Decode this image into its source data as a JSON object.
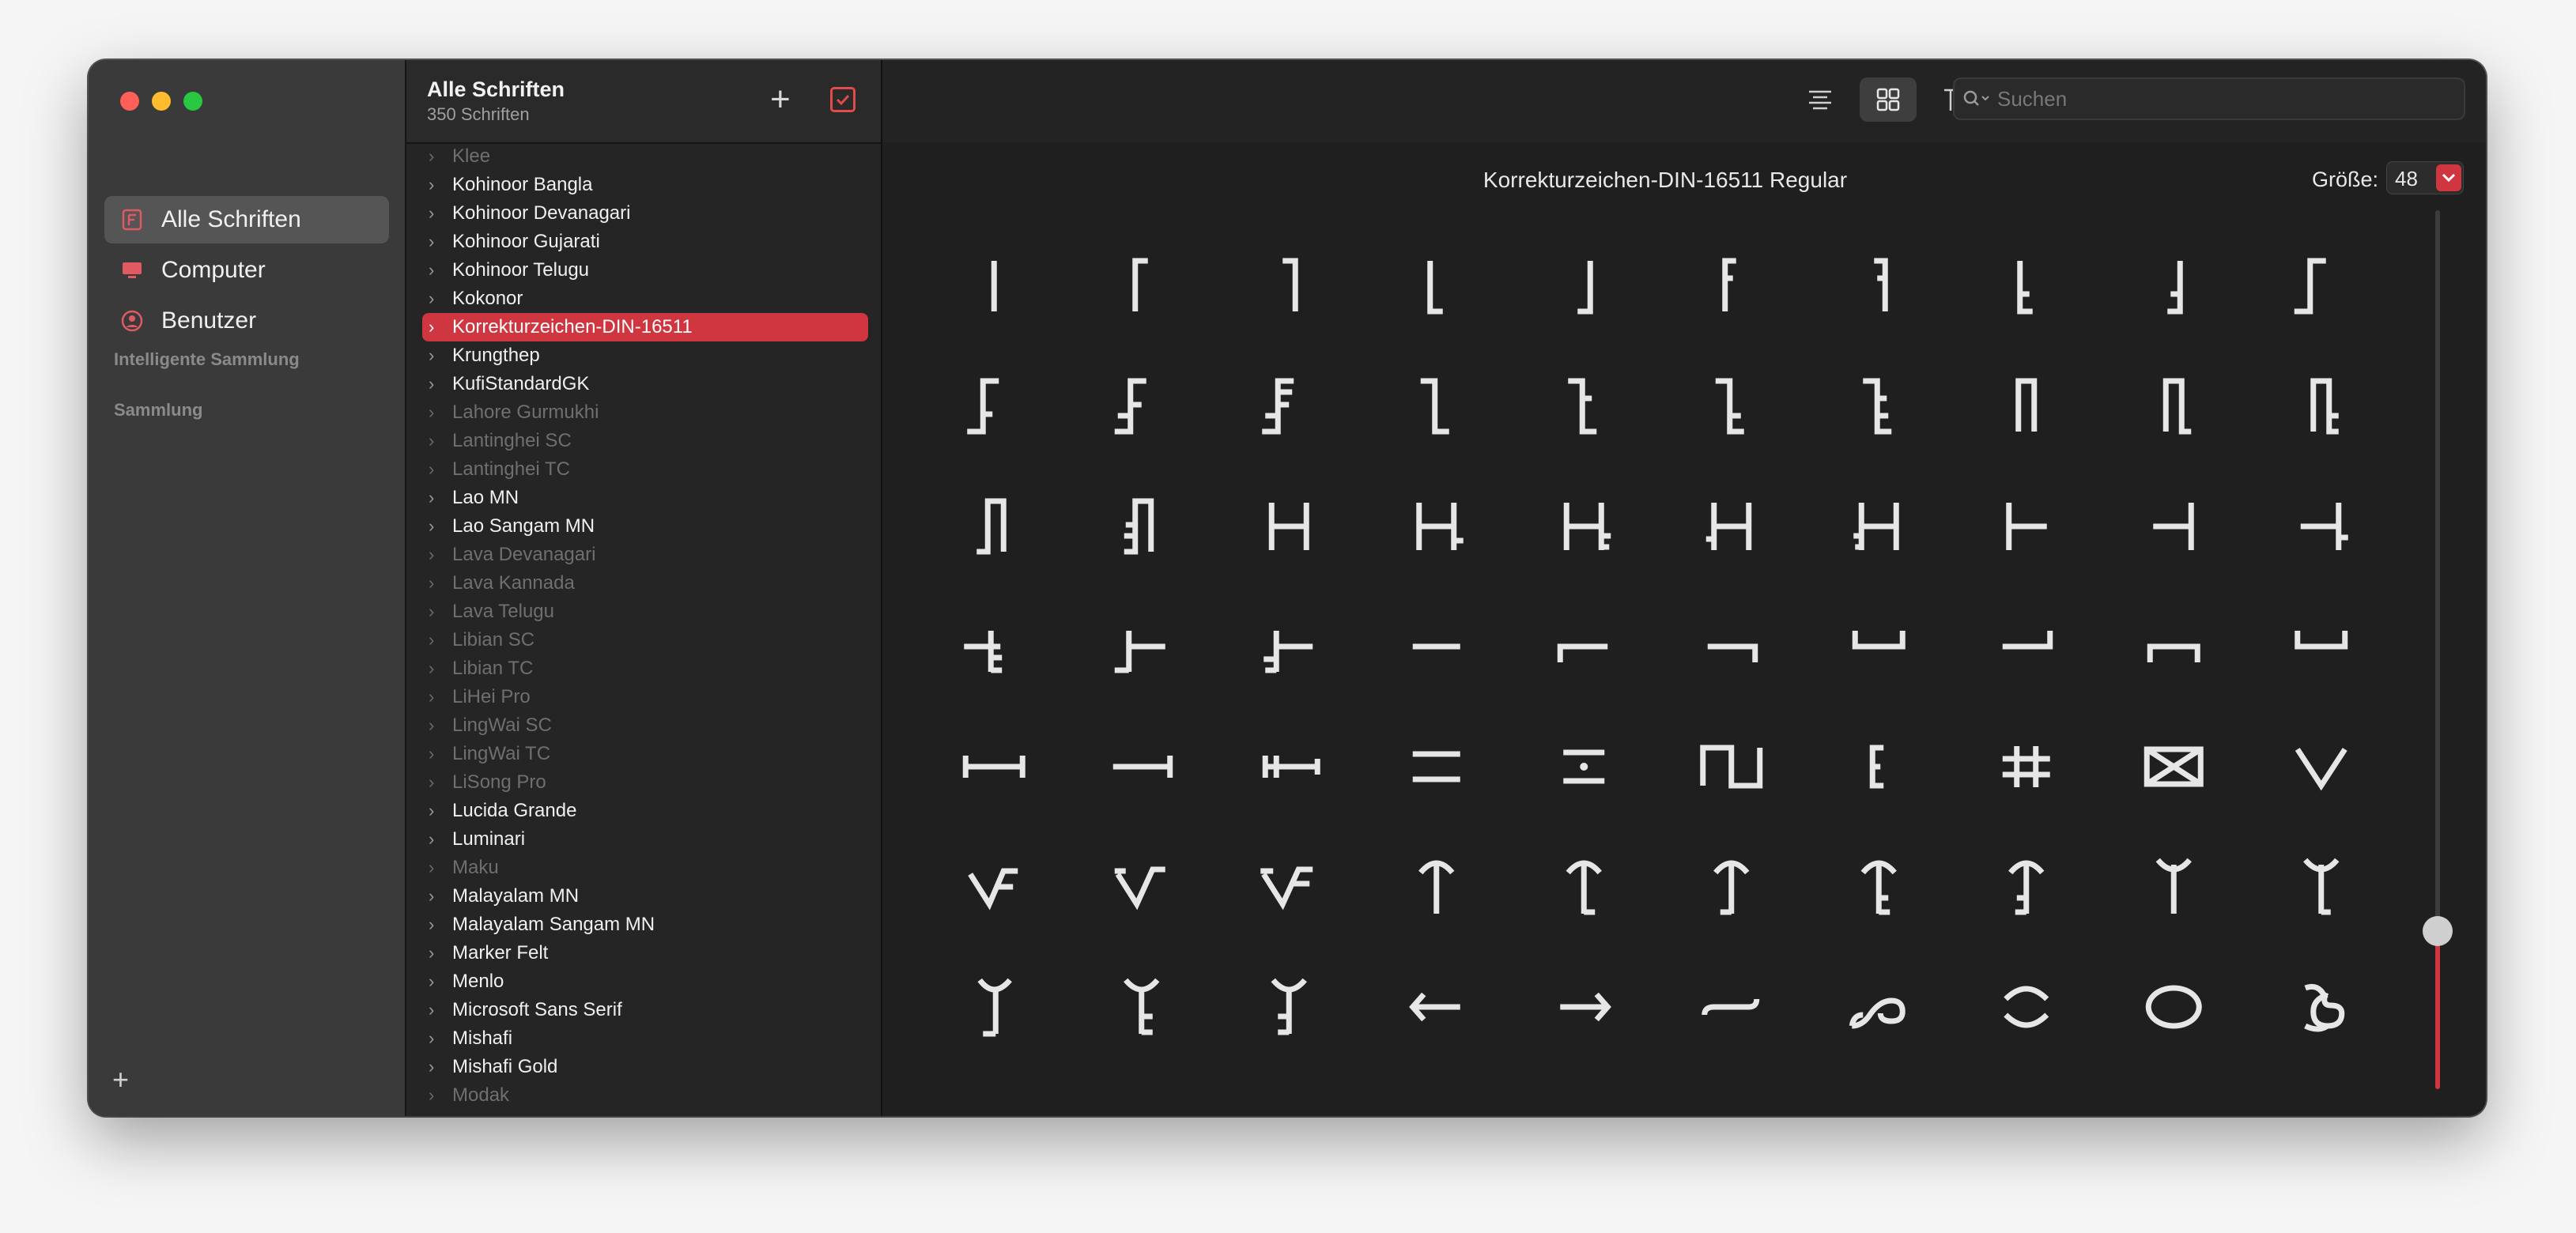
{
  "sidebar": {
    "items": [
      {
        "label": "Alle Schriften",
        "icon": "font-book-icon",
        "active": true
      },
      {
        "label": "Computer",
        "icon": "computer-icon",
        "active": false
      },
      {
        "label": "Benutzer",
        "icon": "user-icon",
        "active": false
      }
    ],
    "sections": [
      "Intelligente Sammlung",
      "Sammlung"
    ],
    "add_symbol": "+"
  },
  "font_list": {
    "title": "Alle Schriften",
    "subtitle": "350 Schriften",
    "fonts": [
      {
        "name": "Klee",
        "dim": true
      },
      {
        "name": "Kohinoor Bangla",
        "dim": false
      },
      {
        "name": "Kohinoor Devanagari",
        "dim": false
      },
      {
        "name": "Kohinoor Gujarati",
        "dim": false
      },
      {
        "name": "Kohinoor Telugu",
        "dim": false
      },
      {
        "name": "Kokonor",
        "dim": false
      },
      {
        "name": "Korrekturzeichen-DIN-16511",
        "dim": false,
        "selected": true
      },
      {
        "name": "Krungthep",
        "dim": false
      },
      {
        "name": "KufiStandardGK",
        "dim": false
      },
      {
        "name": "Lahore Gurmukhi",
        "dim": true
      },
      {
        "name": "Lantinghei SC",
        "dim": true
      },
      {
        "name": "Lantinghei TC",
        "dim": true
      },
      {
        "name": "Lao MN",
        "dim": false
      },
      {
        "name": "Lao Sangam MN",
        "dim": false
      },
      {
        "name": "Lava Devanagari",
        "dim": true
      },
      {
        "name": "Lava Kannada",
        "dim": true
      },
      {
        "name": "Lava Telugu",
        "dim": true
      },
      {
        "name": "Libian SC",
        "dim": true
      },
      {
        "name": "Libian TC",
        "dim": true
      },
      {
        "name": "LiHei Pro",
        "dim": true
      },
      {
        "name": "LingWai SC",
        "dim": true
      },
      {
        "name": "LingWai TC",
        "dim": true
      },
      {
        "name": "LiSong Pro",
        "dim": true
      },
      {
        "name": "Lucida Grande",
        "dim": false
      },
      {
        "name": "Luminari",
        "dim": false
      },
      {
        "name": "Maku",
        "dim": true
      },
      {
        "name": "Malayalam MN",
        "dim": false
      },
      {
        "name": "Malayalam Sangam MN",
        "dim": false
      },
      {
        "name": "Marker Felt",
        "dim": false
      },
      {
        "name": "Menlo",
        "dim": false
      },
      {
        "name": "Microsoft Sans Serif",
        "dim": false
      },
      {
        "name": "Mishafi",
        "dim": false
      },
      {
        "name": "Mishafi Gold",
        "dim": false
      },
      {
        "name": "Modak",
        "dim": true
      }
    ]
  },
  "toolbar": {
    "search_placeholder": "Suchen",
    "active_view": "grid"
  },
  "preview": {
    "font_name": "Korrekturzeichen-DIN-16511 Regular",
    "size_label": "Größe:",
    "size_value": "48",
    "size_slider_fraction": 0.18,
    "glyph_rows": 7,
    "glyph_cols": 10
  },
  "colors": {
    "accent": "#d0363f",
    "glyph": "#e6e6e6",
    "window_bg": "#1f1f1f"
  }
}
